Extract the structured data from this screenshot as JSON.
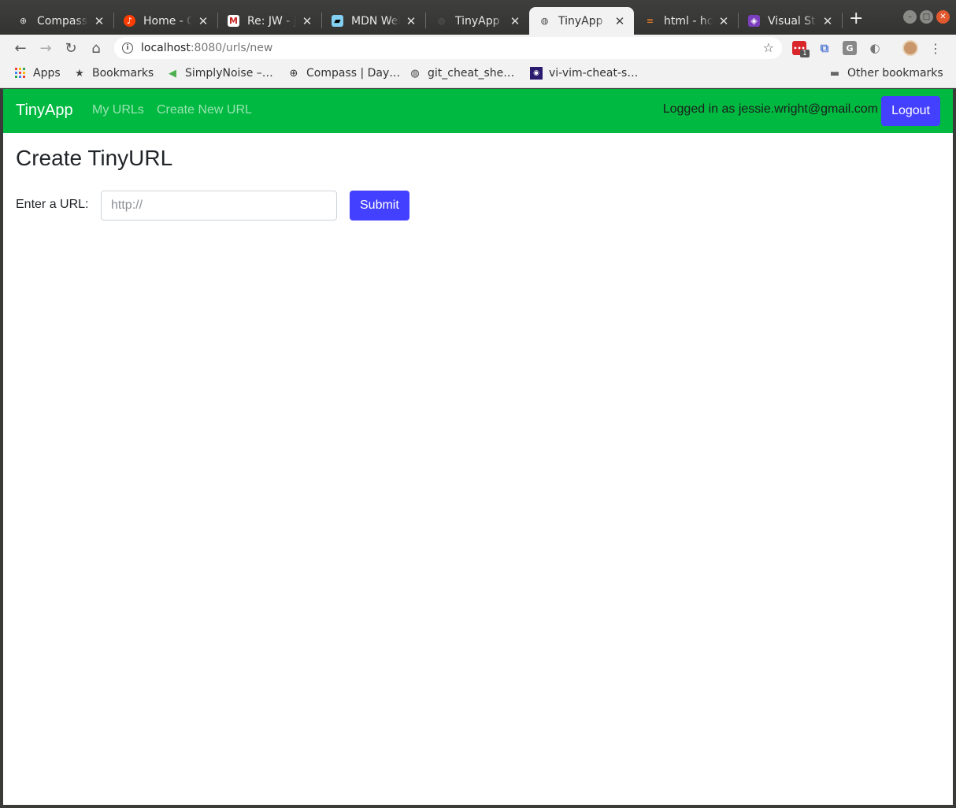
{
  "browser": {
    "tabs": [
      {
        "title": "Compass | Day",
        "icon": "compass-icon",
        "active": false
      },
      {
        "title": "Home - Go",
        "icon": "music-icon",
        "active": false
      },
      {
        "title": "Re: JW - jes",
        "icon": "gmail-icon",
        "active": false
      },
      {
        "title": "MDN Web D",
        "icon": "mdn-icon",
        "active": false
      },
      {
        "title": "TinyApp",
        "icon": "globe-icon",
        "active": false
      },
      {
        "title": "TinyApp",
        "icon": "globe-icon",
        "active": true
      },
      {
        "title": "html - how",
        "icon": "stackoverflow-icon",
        "active": false
      },
      {
        "title": "Visual Stu",
        "icon": "vscode-icon",
        "active": false
      }
    ],
    "new_tab_glyph": "+",
    "close_glyph": "✕",
    "address": {
      "host": "localhost",
      "rest": ":8080/urls/new"
    },
    "extension_badge": "1",
    "bookmarks": [
      {
        "label": "Apps",
        "icon": "apps-grid-icon"
      },
      {
        "label": "Bookmarks",
        "icon": "star-icon"
      },
      {
        "label": "SimplyNoise –…",
        "icon": "speaker-icon"
      },
      {
        "label": "Compass | Day…",
        "icon": "compass-icon"
      },
      {
        "label": "git_cheat_she…",
        "icon": "globe-icon"
      },
      {
        "label": "vi-vim-cheat-s…",
        "icon": "vim-icon"
      }
    ],
    "other_bookmarks": "Other bookmarks"
  },
  "app": {
    "brand": "TinyApp",
    "nav": {
      "my_urls": "My URLs",
      "create_new": "Create New URL"
    },
    "login_text": "Logged in as jessie.wright@gmail.com",
    "logout_label": "Logout",
    "accent_color": "#00b940",
    "button_color": "#4440ff"
  },
  "main": {
    "title": "Create TinyURL",
    "form": {
      "label": "Enter a URL:",
      "placeholder": "http://",
      "value": "",
      "submit_label": "Submit"
    }
  }
}
